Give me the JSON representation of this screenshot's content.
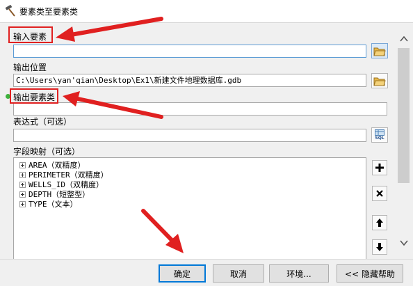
{
  "window": {
    "title": "要素类至要素类",
    "icon": "hammer-tool-icon"
  },
  "form": {
    "input_features": {
      "label": "输入要素",
      "value": ""
    },
    "output_location": {
      "label": "输出位置",
      "value": "C:\\Users\\yan'qian\\Desktop\\Ex1\\新建文件地理数据库.gdb"
    },
    "output_feature_class": {
      "label": "输出要素类",
      "value": ""
    },
    "expression": {
      "label": "表达式（可选）",
      "value": ""
    },
    "field_map": {
      "label": "字段映射（可选）",
      "items": [
        "AREA（双精度）",
        "PERIMETER（双精度）",
        "WELLS_ID（双精度）",
        "DEPTH（短整型）",
        "TYPE（文本）"
      ]
    },
    "sql_button_label": "SQL"
  },
  "side_buttons": [
    "add-icon",
    "remove-icon",
    "move-up-icon",
    "move-down-icon"
  ],
  "footer": {
    "ok": "确定",
    "cancel": "取消",
    "environments": "环境...",
    "hide_help": "<< 隐藏帮助"
  },
  "colors": {
    "annotation_red": "#e02020",
    "required_dot": "#3cb23c",
    "panel_bg": "#f0f0f0",
    "focus_blue": "#0078d7"
  }
}
